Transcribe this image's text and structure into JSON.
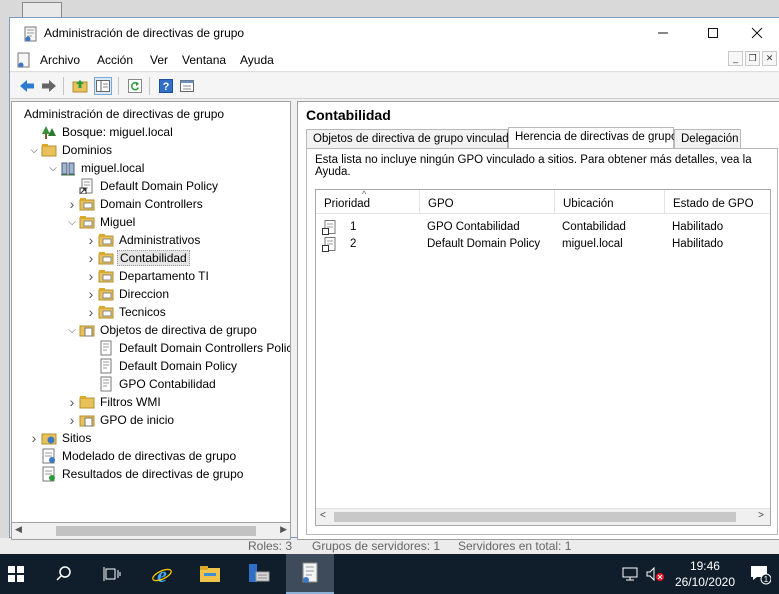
{
  "window": {
    "title": "Administración de directivas de grupo",
    "controls": [
      "minimize",
      "maximize",
      "close"
    ]
  },
  "menu": [
    "Archivo",
    "Acción",
    "Ver",
    "Ventana",
    "Ayuda"
  ],
  "toolbar": {
    "buttons": [
      "back-icon",
      "forward-icon",
      "up-folder-icon",
      "show-hide-tree-icon",
      "refresh-icon",
      "help-icon",
      "properties-icon"
    ]
  },
  "tree": {
    "items": [
      {
        "label": "Administración de directivas de grupo",
        "icon": "none",
        "expander": ""
      },
      {
        "label": "Bosque: miguel.local",
        "icon": "forest-icon",
        "expander": ""
      },
      {
        "label": "Dominios",
        "icon": "folder-icon",
        "expander": "expanded"
      },
      {
        "label": "miguel.local",
        "icon": "domain-icon",
        "expander": "expanded"
      },
      {
        "label": "Default Domain Policy",
        "icon": "gpo-link-icon",
        "expander": ""
      },
      {
        "label": "Domain Controllers",
        "icon": "ou-icon",
        "expander": "collapsed"
      },
      {
        "label": "Miguel",
        "icon": "ou-icon",
        "expander": "expanded"
      },
      {
        "label": "Administrativos",
        "icon": "ou-icon",
        "expander": "collapsed"
      },
      {
        "label": "Contabilidad",
        "icon": "ou-icon",
        "expander": "collapsed",
        "selected": true
      },
      {
        "label": "Departamento TI",
        "icon": "ou-icon",
        "expander": "collapsed"
      },
      {
        "label": "Direccion",
        "icon": "ou-icon",
        "expander": "collapsed"
      },
      {
        "label": "Tecnicos",
        "icon": "ou-icon",
        "expander": "collapsed"
      },
      {
        "label": "Objetos de directiva de grupo",
        "icon": "gpo-folder-icon",
        "expander": "expanded"
      },
      {
        "label": "Default Domain Controllers Policy",
        "icon": "gpo-icon",
        "expander": ""
      },
      {
        "label": "Default Domain Policy",
        "icon": "gpo-icon",
        "expander": ""
      },
      {
        "label": "GPO Contabilidad",
        "icon": "gpo-icon",
        "expander": ""
      },
      {
        "label": "Filtros WMI",
        "icon": "folder-icon",
        "expander": "collapsed"
      },
      {
        "label": "GPO de inicio",
        "icon": "gpo-folder-icon",
        "expander": "collapsed"
      },
      {
        "label": "Sitios",
        "icon": "sites-icon",
        "expander": "collapsed"
      },
      {
        "label": "Modelado de directivas de grupo",
        "icon": "modeling-icon",
        "expander": ""
      },
      {
        "label": "Resultados de directivas de grupo",
        "icon": "results-icon",
        "expander": ""
      }
    ]
  },
  "details": {
    "title": "Contabilidad",
    "tabs": [
      {
        "label": "Objetos de directiva de grupo vinculados",
        "active": false
      },
      {
        "label": "Herencia de directivas de grupo",
        "active": true
      },
      {
        "label": "Delegación",
        "active": false
      }
    ],
    "description": "Esta lista no incluye ningún GPO vinculado a sitios. Para obtener más detalles, vea la Ayuda.",
    "columns": [
      "Prioridad",
      "GPO",
      "Ubicación",
      "Estado de GPO"
    ],
    "rows": [
      {
        "priority": "1",
        "gpo": "GPO Contabilidad",
        "location": "Contabilidad",
        "status": "Habilitado"
      },
      {
        "priority": "2",
        "gpo": "Default Domain Policy",
        "location": "miguel.local",
        "status": "Habilitado"
      }
    ]
  },
  "background_status": {
    "roles": "Roles: 3",
    "groups": "Grupos de servidores: 1",
    "servers": "Servidores en total: 1"
  },
  "taskbar": {
    "apps": [
      "start-icon",
      "search-icon",
      "task-view-icon",
      "internet-explorer-icon",
      "file-explorer-icon",
      "server-manager-icon",
      "gpmc-icon"
    ],
    "time": "19:46",
    "date": "26/10/2020",
    "notification_count": "1"
  },
  "colors": {
    "taskbar": "#101d2b",
    "selection": "#e5e5e5",
    "folder": "#e8c15a"
  }
}
